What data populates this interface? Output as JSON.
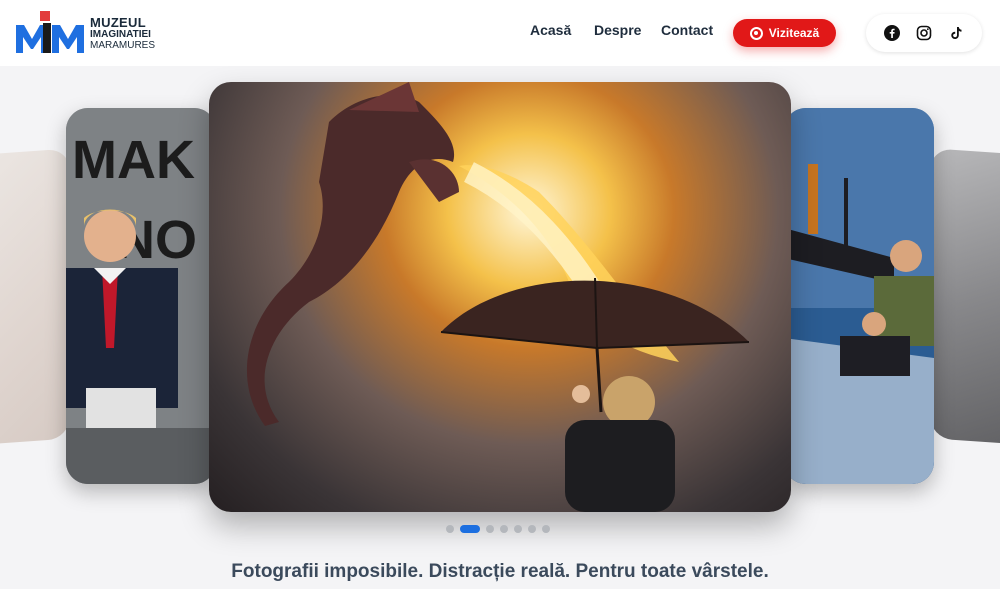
{
  "logo": {
    "line1": "MUZEUL",
    "line2": "IMAGINATIEI",
    "line3": "MARAMURES",
    "icon": "mim-logo"
  },
  "nav": {
    "items": [
      "Acasă",
      "Despre",
      "Contact"
    ]
  },
  "cta": {
    "label": "Vizitează",
    "icon": "target-icon",
    "color": "#e11818"
  },
  "socials": {
    "items": [
      "facebook-icon",
      "instagram-icon",
      "tiktok-icon"
    ]
  },
  "carousel": {
    "slides_count": 7,
    "active_index": 1,
    "active_color": "#1d6fe0",
    "slides": [
      {
        "id": "left-side",
        "text": "MAK NO"
      },
      {
        "id": "center-dragon"
      },
      {
        "id": "right-side"
      }
    ]
  },
  "tagline": "Fotografii imposibile. Distracție reală. Pentru toate vârstele."
}
